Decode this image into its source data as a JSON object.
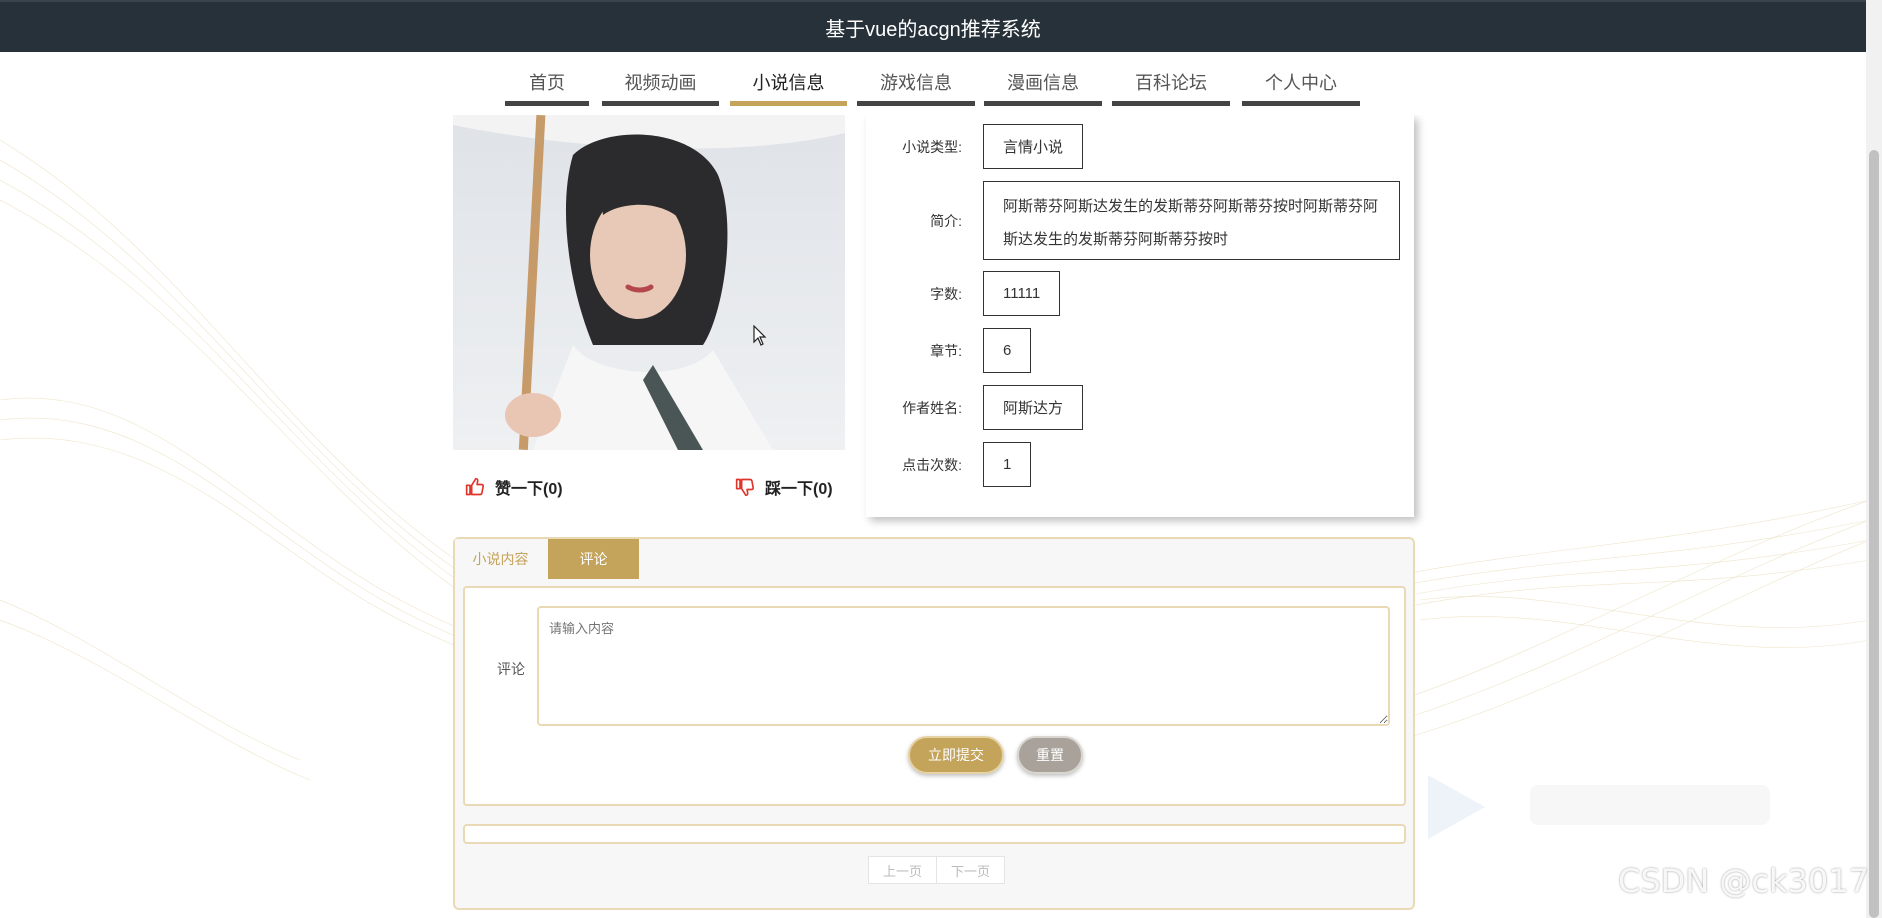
{
  "header": {
    "title": "基于vue的acgn推荐系统"
  },
  "nav": {
    "items": [
      {
        "label": "首页"
      },
      {
        "label": "视频动画"
      },
      {
        "label": "小说信息"
      },
      {
        "label": "游戏信息"
      },
      {
        "label": "漫画信息"
      },
      {
        "label": "百科论坛"
      },
      {
        "label": "个人中心"
      }
    ],
    "active_index": 2,
    "active_color": "#c4a35a"
  },
  "cover": {
    "icon": "cover-image"
  },
  "votes": {
    "like_label": "赞一下(0)",
    "dislike_label": "踩一下(0)",
    "like_color": "#e0352b"
  },
  "detail": {
    "type": {
      "label": "小说类型:",
      "value": "言情小说"
    },
    "intro": {
      "label": "简介:",
      "value": "阿斯蒂芬阿斯达发生的发斯蒂芬阿斯蒂芬按时阿斯蒂芬阿斯达发生的发斯蒂芬阿斯蒂芬按时"
    },
    "words": {
      "label": "字数:",
      "value": "11111"
    },
    "chapters": {
      "label": "章节:",
      "value": "6"
    },
    "author": {
      "label": "作者姓名:",
      "value": "阿斯达方"
    },
    "clicks": {
      "label": "点击次数:",
      "value": "1"
    }
  },
  "tabs": {
    "novel_content": "小说内容",
    "comment": "评论",
    "active": "comment"
  },
  "comment_form": {
    "label": "评论",
    "placeholder": "请输入内容",
    "submit_label": "立即提交",
    "reset_label": "重置"
  },
  "pager": {
    "prev_label": "上一页",
    "next_label": "下一页"
  },
  "watermark": "CSDN @ck3017"
}
